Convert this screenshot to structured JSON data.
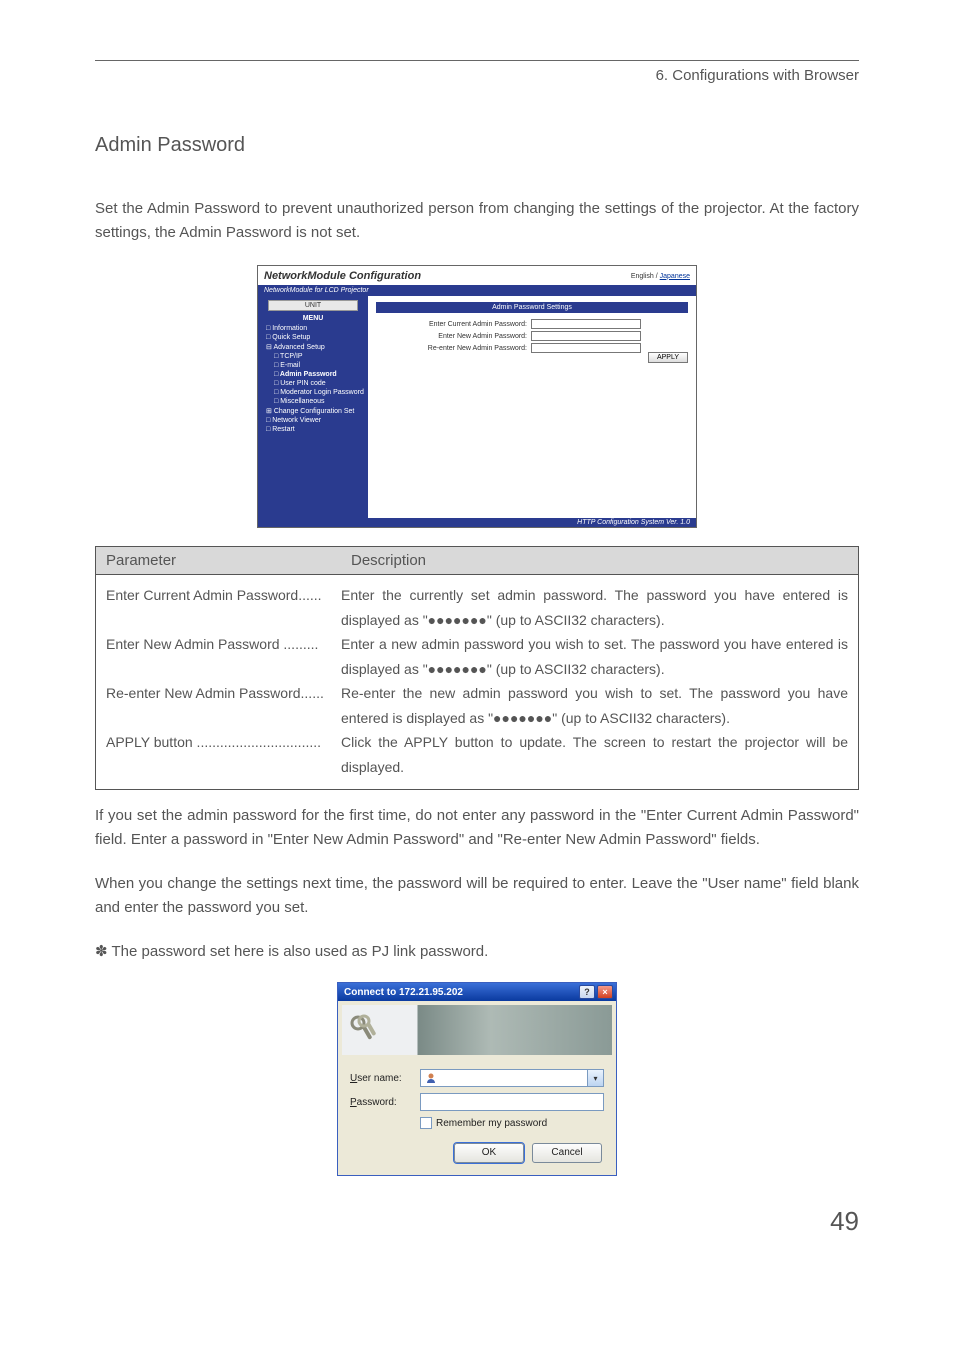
{
  "chapter": "6. Configurations with Browser",
  "section_title": "Admin Password",
  "intro_text": "Set the Admin Password to prevent unauthorized person from changing the settings of the projector. At the factory settings, the Admin Password is not set.",
  "config_shot": {
    "title": "NetworkModule Configuration",
    "lang_english": "English",
    "lang_japanese": "Japanese",
    "subbar": "NetworkModule for LCD Projector",
    "unit_label": "UNIT",
    "menu_label": "MENU",
    "menu": {
      "information": "Information",
      "quick_setup": "Quick Setup",
      "advanced_setup": "Advanced Setup",
      "tcpip": "TCP/IP",
      "email": "E-mail",
      "admin_password": "Admin Password",
      "user_pincode": "User PIN code",
      "moderator_login": "Moderator Login Password",
      "miscellaneous": "Miscellaneous",
      "change_config": "Change Configuration Set",
      "network_viewer": "Network Viewer",
      "restart": "Restart"
    },
    "content_title": "Admin Password Settings",
    "fields": {
      "enter_current": "Enter Current Admin Password:",
      "enter_new": "Enter New Admin Password:",
      "reenter_new": "Re-enter New Admin Password:"
    },
    "apply_btn": "APPLY",
    "footer": "HTTP Configuration System Ver. 1.0"
  },
  "table": {
    "head_param": "Parameter",
    "head_desc": "Description",
    "rows": [
      {
        "name": "Enter Current Admin Password......",
        "desc": "Enter the currently set admin password. The password you have entered is displayed as \"●●●●●●●\" (up to ASCII32 characters)."
      },
      {
        "name": "Enter New Admin Password .........",
        "desc": "Enter a new admin password you wish to set. The password you have entered is displayed as \"●●●●●●●\" (up to ASCII32 characters)."
      },
      {
        "name": "Re-enter New Admin Password......",
        "desc": "Re-enter the new admin password you wish to set. The password you have entered is displayed as \"●●●●●●●\" (up to ASCII32 characters)."
      },
      {
        "name": "APPLY button ................................",
        "desc": "Click the APPLY button to update. The screen to restart the projector will be displayed."
      }
    ]
  },
  "para_after_table": "If you set the admin password for the first time, do not enter any password in the \"Enter Current Admin Password\" field. Enter a password in \"Enter New Admin Password\" and \"Re-enter New Admin Password\" fields.",
  "para_next_time": "When you change the settings next time, the password will be required to enter. Leave the \"User name\" field blank and enter the password you set.",
  "note_pjlink": "✽ The password set here is also used as PJ link password.",
  "auth": {
    "title": "Connect to 172.21.95.202",
    "user_label_pre": "U",
    "user_label_post": "ser name:",
    "pass_label_pre": "P",
    "pass_label_post": "assword:",
    "remember_pre": "R",
    "remember_post": "emember my password",
    "username_value": "",
    "ok": "OK",
    "cancel": "Cancel"
  },
  "page_number": "49"
}
